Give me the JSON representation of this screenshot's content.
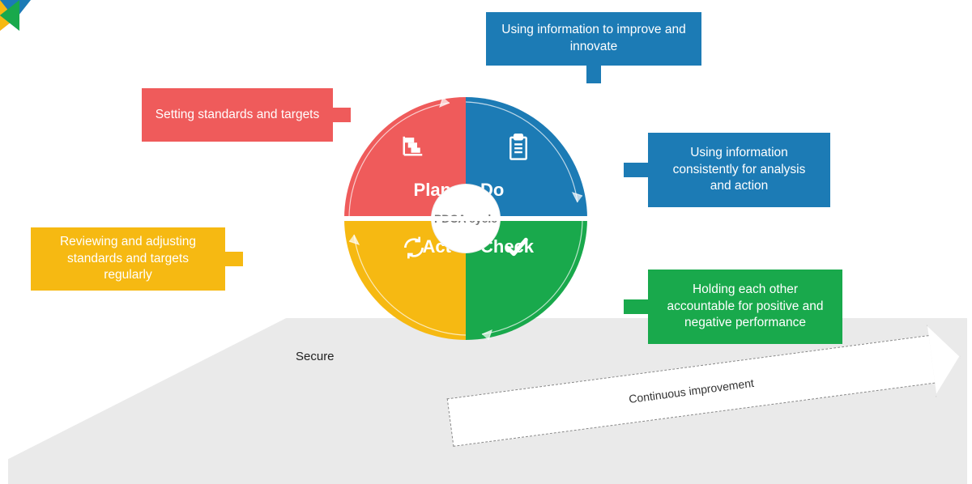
{
  "hub_label": "PDCA cycle",
  "quadrants": {
    "plan": {
      "label": "Plan",
      "color": "#ef5b5b",
      "icon": "gantt-icon"
    },
    "do": {
      "label": "Do",
      "color": "#1c7bb5",
      "icon": "clipboard-icon"
    },
    "check": {
      "label": "Check",
      "color": "#19a94c",
      "icon": "checkmark-icon"
    },
    "act": {
      "label": "Act",
      "color": "#f6b912",
      "icon": "cycle-arrows-icon"
    }
  },
  "callouts": {
    "plan": "Setting standards and targets",
    "do_top": "Using information to improve and innovate",
    "do_right": "Using information consistently for analysis and action",
    "check": "Holding each other accountable for positive and negative performance",
    "act": "Reviewing and adjusting standards and targets regularly"
  },
  "base": {
    "secure_label": "Secure",
    "progress_label": "Continuous improvement"
  }
}
